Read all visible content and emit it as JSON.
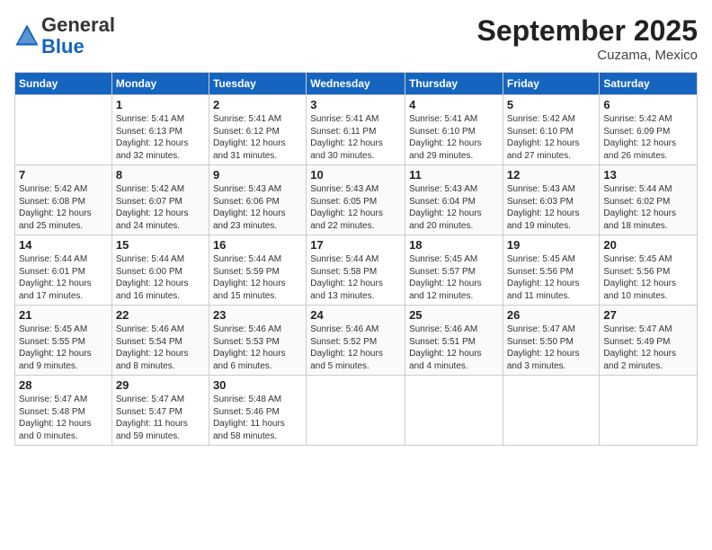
{
  "header": {
    "logo_general": "General",
    "logo_blue": "Blue",
    "month_title": "September 2025",
    "location": "Cuzama, Mexico"
  },
  "weekdays": [
    "Sunday",
    "Monday",
    "Tuesday",
    "Wednesday",
    "Thursday",
    "Friday",
    "Saturday"
  ],
  "weeks": [
    [
      {
        "day": "",
        "info": ""
      },
      {
        "day": "1",
        "info": "Sunrise: 5:41 AM\nSunset: 6:13 PM\nDaylight: 12 hours\nand 32 minutes."
      },
      {
        "day": "2",
        "info": "Sunrise: 5:41 AM\nSunset: 6:12 PM\nDaylight: 12 hours\nand 31 minutes."
      },
      {
        "day": "3",
        "info": "Sunrise: 5:41 AM\nSunset: 6:11 PM\nDaylight: 12 hours\nand 30 minutes."
      },
      {
        "day": "4",
        "info": "Sunrise: 5:41 AM\nSunset: 6:10 PM\nDaylight: 12 hours\nand 29 minutes."
      },
      {
        "day": "5",
        "info": "Sunrise: 5:42 AM\nSunset: 6:10 PM\nDaylight: 12 hours\nand 27 minutes."
      },
      {
        "day": "6",
        "info": "Sunrise: 5:42 AM\nSunset: 6:09 PM\nDaylight: 12 hours\nand 26 minutes."
      }
    ],
    [
      {
        "day": "7",
        "info": "Sunrise: 5:42 AM\nSunset: 6:08 PM\nDaylight: 12 hours\nand 25 minutes."
      },
      {
        "day": "8",
        "info": "Sunrise: 5:42 AM\nSunset: 6:07 PM\nDaylight: 12 hours\nand 24 minutes."
      },
      {
        "day": "9",
        "info": "Sunrise: 5:43 AM\nSunset: 6:06 PM\nDaylight: 12 hours\nand 23 minutes."
      },
      {
        "day": "10",
        "info": "Sunrise: 5:43 AM\nSunset: 6:05 PM\nDaylight: 12 hours\nand 22 minutes."
      },
      {
        "day": "11",
        "info": "Sunrise: 5:43 AM\nSunset: 6:04 PM\nDaylight: 12 hours\nand 20 minutes."
      },
      {
        "day": "12",
        "info": "Sunrise: 5:43 AM\nSunset: 6:03 PM\nDaylight: 12 hours\nand 19 minutes."
      },
      {
        "day": "13",
        "info": "Sunrise: 5:44 AM\nSunset: 6:02 PM\nDaylight: 12 hours\nand 18 minutes."
      }
    ],
    [
      {
        "day": "14",
        "info": "Sunrise: 5:44 AM\nSunset: 6:01 PM\nDaylight: 12 hours\nand 17 minutes."
      },
      {
        "day": "15",
        "info": "Sunrise: 5:44 AM\nSunset: 6:00 PM\nDaylight: 12 hours\nand 16 minutes."
      },
      {
        "day": "16",
        "info": "Sunrise: 5:44 AM\nSunset: 5:59 PM\nDaylight: 12 hours\nand 15 minutes."
      },
      {
        "day": "17",
        "info": "Sunrise: 5:44 AM\nSunset: 5:58 PM\nDaylight: 12 hours\nand 13 minutes."
      },
      {
        "day": "18",
        "info": "Sunrise: 5:45 AM\nSunset: 5:57 PM\nDaylight: 12 hours\nand 12 minutes."
      },
      {
        "day": "19",
        "info": "Sunrise: 5:45 AM\nSunset: 5:56 PM\nDaylight: 12 hours\nand 11 minutes."
      },
      {
        "day": "20",
        "info": "Sunrise: 5:45 AM\nSunset: 5:56 PM\nDaylight: 12 hours\nand 10 minutes."
      }
    ],
    [
      {
        "day": "21",
        "info": "Sunrise: 5:45 AM\nSunset: 5:55 PM\nDaylight: 12 hours\nand 9 minutes."
      },
      {
        "day": "22",
        "info": "Sunrise: 5:46 AM\nSunset: 5:54 PM\nDaylight: 12 hours\nand 8 minutes."
      },
      {
        "day": "23",
        "info": "Sunrise: 5:46 AM\nSunset: 5:53 PM\nDaylight: 12 hours\nand 6 minutes."
      },
      {
        "day": "24",
        "info": "Sunrise: 5:46 AM\nSunset: 5:52 PM\nDaylight: 12 hours\nand 5 minutes."
      },
      {
        "day": "25",
        "info": "Sunrise: 5:46 AM\nSunset: 5:51 PM\nDaylight: 12 hours\nand 4 minutes."
      },
      {
        "day": "26",
        "info": "Sunrise: 5:47 AM\nSunset: 5:50 PM\nDaylight: 12 hours\nand 3 minutes."
      },
      {
        "day": "27",
        "info": "Sunrise: 5:47 AM\nSunset: 5:49 PM\nDaylight: 12 hours\nand 2 minutes."
      }
    ],
    [
      {
        "day": "28",
        "info": "Sunrise: 5:47 AM\nSunset: 5:48 PM\nDaylight: 12 hours\nand 0 minutes."
      },
      {
        "day": "29",
        "info": "Sunrise: 5:47 AM\nSunset: 5:47 PM\nDaylight: 11 hours\nand 59 minutes."
      },
      {
        "day": "30",
        "info": "Sunrise: 5:48 AM\nSunset: 5:46 PM\nDaylight: 11 hours\nand 58 minutes."
      },
      {
        "day": "",
        "info": ""
      },
      {
        "day": "",
        "info": ""
      },
      {
        "day": "",
        "info": ""
      },
      {
        "day": "",
        "info": ""
      }
    ]
  ]
}
